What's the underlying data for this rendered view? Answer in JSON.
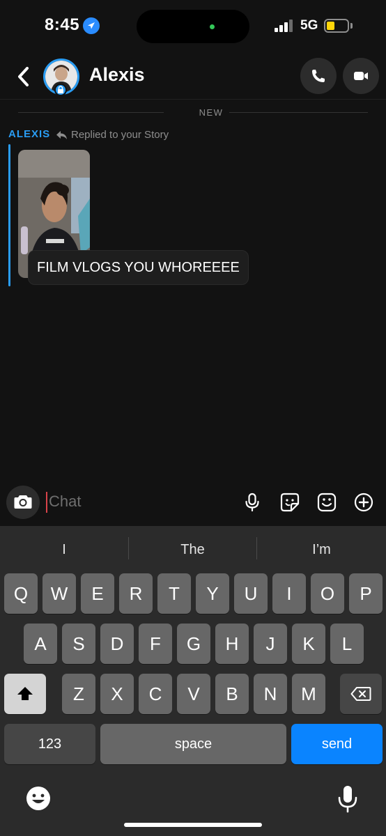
{
  "status_bar": {
    "time": "8:45",
    "network": "5G",
    "battery_level": 0.25,
    "icons": [
      "location-arrow-icon",
      "signal-bars-icon",
      "battery-icon"
    ]
  },
  "header": {
    "contact_name": "Alexis",
    "icons": [
      "back-chevron-icon",
      "phone-icon",
      "video-camera-icon",
      "lock-icon"
    ]
  },
  "messages": {
    "new_separator": "NEW",
    "sender": "ALEXIS",
    "reply_context": "Replied to your Story",
    "text": "FILM VLOGS YOU WHOREEEE"
  },
  "input": {
    "placeholder": "Chat",
    "icons": [
      "camera-icon",
      "microphone-icon",
      "sticker-icon",
      "gallery-icon",
      "plus-circle-icon"
    ]
  },
  "keyboard": {
    "suggestions": [
      "I",
      "The",
      "I’m"
    ],
    "row1": [
      "Q",
      "W",
      "E",
      "R",
      "T",
      "Y",
      "U",
      "I",
      "O",
      "P"
    ],
    "row2": [
      "A",
      "S",
      "D",
      "F",
      "G",
      "H",
      "J",
      "K",
      "L"
    ],
    "row3": [
      "Z",
      "X",
      "C",
      "V",
      "B",
      "N",
      "M"
    ],
    "numbers_label": "123",
    "space_label": "space",
    "send_label": "send",
    "icons": [
      "shift-icon",
      "delete-icon",
      "emoji-icon",
      "dictation-icon"
    ]
  },
  "colors": {
    "accent_blue": "#2a9df4",
    "send_blue": "#0a84ff",
    "background": "#121212",
    "keyboard_bg": "#2b2b2b"
  }
}
